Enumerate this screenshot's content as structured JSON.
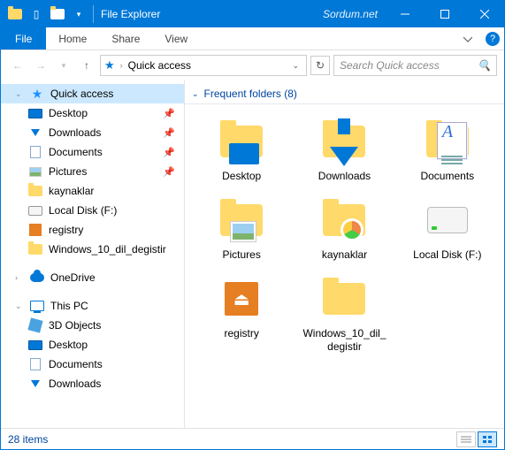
{
  "titlebar": {
    "title": "File Explorer",
    "watermark": "Sordum.net"
  },
  "ribbon": {
    "file": "File",
    "tabs": [
      "Home",
      "Share",
      "View"
    ]
  },
  "nav": {
    "crumb": "Quick access",
    "search_placeholder": "Search Quick access"
  },
  "sidebar": {
    "quick_access": "Quick access",
    "qa_items": [
      {
        "label": "Desktop",
        "pinned": true
      },
      {
        "label": "Downloads",
        "pinned": true
      },
      {
        "label": "Documents",
        "pinned": true
      },
      {
        "label": "Pictures",
        "pinned": true
      },
      {
        "label": "kaynaklar",
        "pinned": false
      },
      {
        "label": "Local Disk (F:)",
        "pinned": false
      },
      {
        "label": "registry",
        "pinned": false
      },
      {
        "label": "Windows_10_dil_degistir",
        "pinned": false
      }
    ],
    "onedrive": "OneDrive",
    "thispc": "This PC",
    "pc_items": [
      "3D Objects",
      "Desktop",
      "Documents",
      "Downloads"
    ]
  },
  "content": {
    "group_header": "Frequent folders (8)",
    "items": [
      {
        "label": "Desktop",
        "kind": "desktop"
      },
      {
        "label": "Downloads",
        "kind": "downloads"
      },
      {
        "label": "Documents",
        "kind": "documents"
      },
      {
        "label": "Pictures",
        "kind": "pictures"
      },
      {
        "label": "kaynaklar",
        "kind": "chrome"
      },
      {
        "label": "Local Disk (F:)",
        "kind": "disk"
      },
      {
        "label": "registry",
        "kind": "registry"
      },
      {
        "label": "Windows_10_dil_degistir",
        "kind": "folder"
      }
    ]
  },
  "status": {
    "count": "28 items"
  }
}
